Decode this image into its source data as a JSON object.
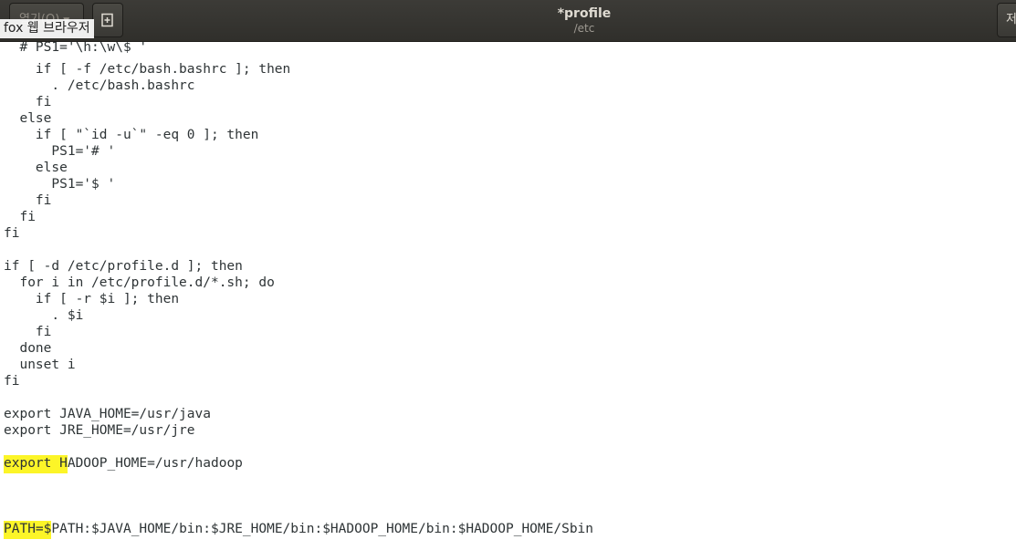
{
  "header": {
    "open_label": "열기(O)",
    "title": "*profile",
    "subtitle": "/etc",
    "save_label": "저",
    "tooltip": "fox 웹 브라우저"
  },
  "editor": {
    "lines": [
      "  # PS1='\\h:\\w\\$ '",
      "    if [ -f /etc/bash.bashrc ]; then",
      "      . /etc/bash.bashrc",
      "    fi",
      "  else",
      "    if [ \"`id -u`\" -eq 0 ]; then",
      "      PS1='# '",
      "    else",
      "      PS1='$ '",
      "    fi",
      "  fi",
      "fi",
      "",
      "if [ -d /etc/profile.d ]; then",
      "  for i in /etc/profile.d/*.sh; do",
      "    if [ -r $i ]; then",
      "      . $i",
      "    fi",
      "  done",
      "  unset i",
      "fi",
      "",
      "export JAVA_HOME=/usr/java",
      "export JRE_HOME=/usr/jre",
      "",
      "",
      "",
      "",
      ""
    ],
    "hadoop_line": {
      "highlight": "export H",
      "rest": "ADOOP_HOME=/usr/hadoop"
    },
    "path_line": {
      "highlight": "PATH=$",
      "rest": "PATH:$JAVA_HOME/bin:$JRE_HOME/bin:$HADOOP_HOME/bin:$HADOOP_HOME/Sbin"
    },
    "highlight_color": "#fcf528"
  }
}
